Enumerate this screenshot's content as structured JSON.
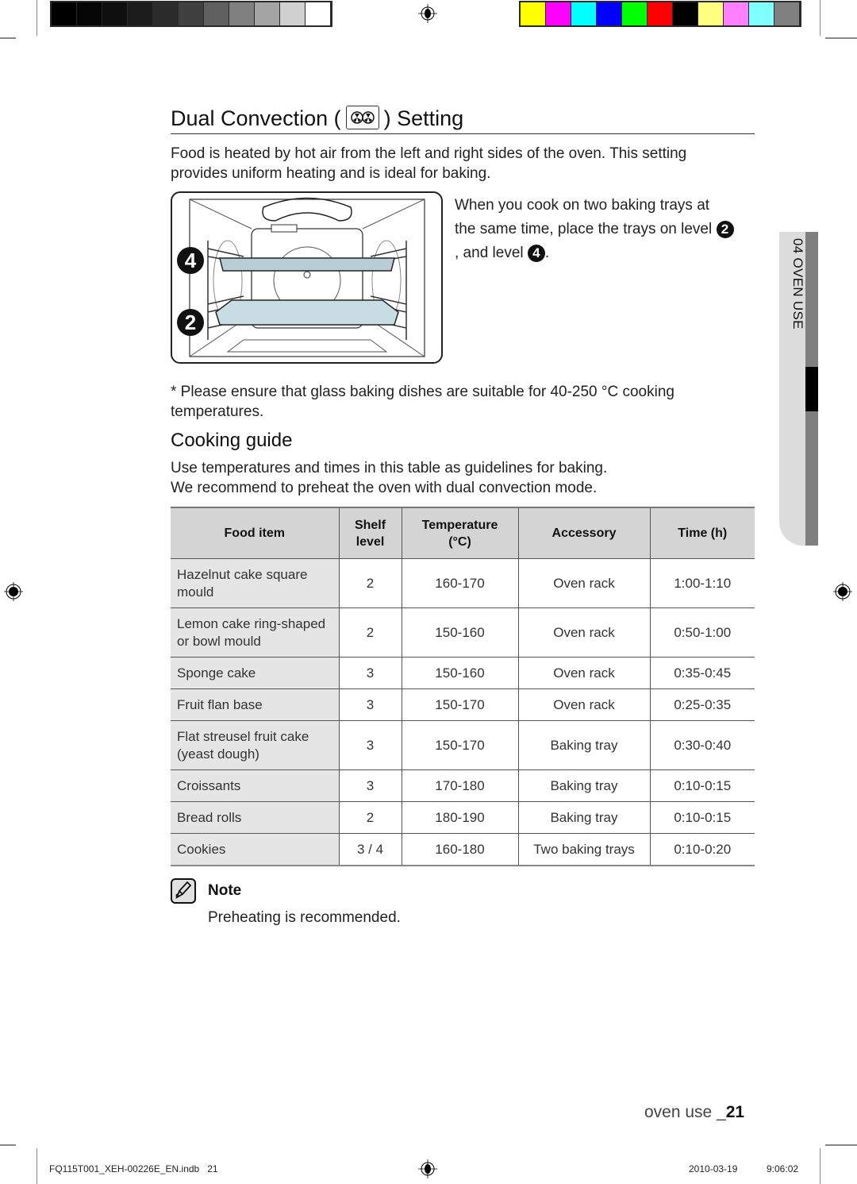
{
  "print_marks": {
    "gray_swatches": [
      "#000000",
      "#050505",
      "#0f0f0f",
      "#1b1b1b",
      "#2b2b2b",
      "#404040",
      "#606060",
      "#808080",
      "#a4a4a4",
      "#d0d0d0",
      "#ffffff"
    ],
    "color_swatches": [
      "#ffff00",
      "#ff00ff",
      "#00ffff",
      "#0000ff",
      "#00ff00",
      "#ff0000",
      "#000000",
      "#ffff80",
      "#ff80ff",
      "#80ffff",
      "#808080"
    ]
  },
  "section": {
    "title_before": "Dual Convection (",
    "title_after": ") Setting",
    "icon": "dual-convection-fan-icon",
    "intro": "Food is heated by hot air from the left and right sides of the oven. This setting provides uniform heating and is ideal for baking."
  },
  "illustration": {
    "level_upper": "4",
    "level_lower": "2",
    "caption_line1": "When you cook on two baking trays at",
    "caption_line2": "the same time, place the trays on level",
    "caption_level_a": "2",
    "caption_line3": ", and level",
    "caption_level_b": "4",
    "caption_end": "."
  },
  "footnote": "*  Please ensure that glass baking dishes are suitable for 40-250 °C cooking temperatures.",
  "cooking_guide": {
    "title": "Cooking guide",
    "line1": "Use temperatures and times in this table as guidelines for baking.",
    "line2": "We recommend to preheat the oven with dual convection mode.",
    "columns": [
      "Food item",
      "Shelf level",
      "Temperature (°C)",
      "Accessory",
      "Time (h)"
    ],
    "rows": [
      {
        "food": "Hazelnut cake square mould",
        "shelf": "2",
        "temp": "160-170",
        "accessory": "Oven rack",
        "time": "1:00-1:10"
      },
      {
        "food": "Lemon cake ring-shaped or bowl mould",
        "shelf": "2",
        "temp": "150-160",
        "accessory": "Oven rack",
        "time": "0:50-1:00"
      },
      {
        "food": "Sponge cake",
        "shelf": "3",
        "temp": "150-160",
        "accessory": "Oven rack",
        "time": "0:35-0:45"
      },
      {
        "food": "Fruit flan base",
        "shelf": "3",
        "temp": "150-170",
        "accessory": "Oven rack",
        "time": "0:25-0:35"
      },
      {
        "food": "Flat streusel fruit cake (yeast dough)",
        "shelf": "3",
        "temp": "150-170",
        "accessory": "Baking tray",
        "time": "0:30-0:40"
      },
      {
        "food": "Croissants",
        "shelf": "3",
        "temp": "170-180",
        "accessory": "Baking tray",
        "time": "0:10-0:15"
      },
      {
        "food": "Bread rolls",
        "shelf": "2",
        "temp": "180-190",
        "accessory": "Baking tray",
        "time": "0:10-0:15"
      },
      {
        "food": "Cookies",
        "shelf": "3 / 4",
        "temp": "160-180",
        "accessory": "Two baking trays",
        "time": "0:10-0:20"
      }
    ]
  },
  "note": {
    "title": "Note",
    "text": "Preheating is recommended."
  },
  "side_tab": {
    "label": "04 OVEN USE"
  },
  "page_footer": {
    "section": "oven use _",
    "page": "21"
  },
  "print_slug": {
    "file": "FQ115T001_XEH-00226E_EN.indb   21",
    "date": "2010-03-19",
    "time": "9:06:02"
  }
}
